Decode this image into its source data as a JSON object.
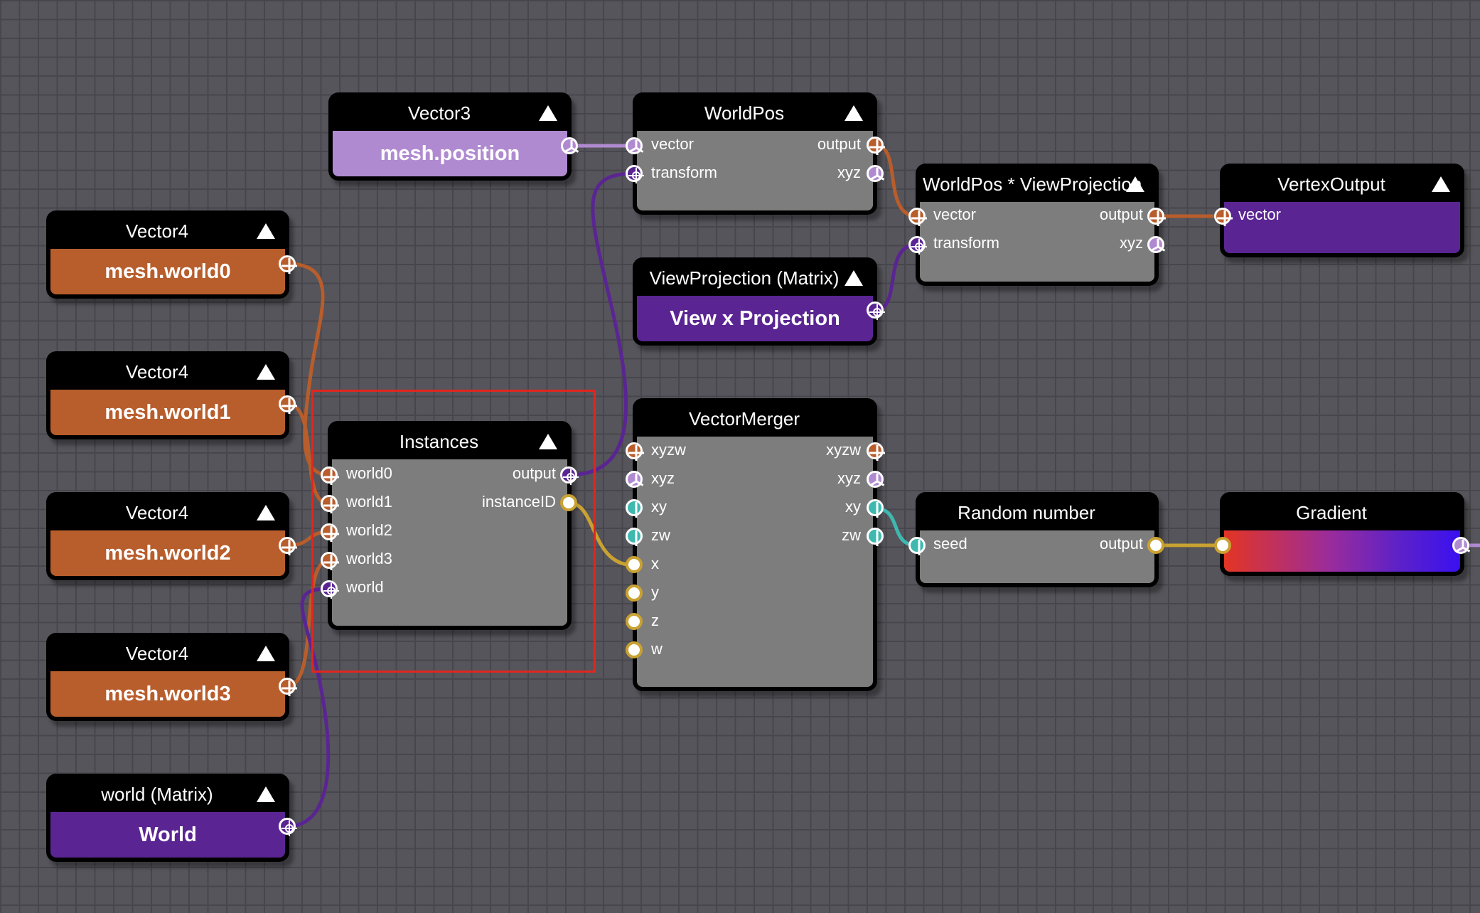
{
  "colors": {
    "vec4": "#b85d2c",
    "vec3": "#b08ad0",
    "matrix": "#5a2593",
    "vec2": "#3fb8b0",
    "float": "#c9a232",
    "node_body": "#7d7d7d",
    "selection": "#e0261f"
  },
  "nodes": {
    "vector3": {
      "title": "Vector3",
      "value": "mesh.position"
    },
    "worldpos": {
      "title": "WorldPos",
      "inputs": [
        "vector",
        "transform"
      ],
      "outputs": [
        "output",
        "xyz"
      ]
    },
    "vector4_0": {
      "title": "Vector4",
      "value": "mesh.world0"
    },
    "vector4_1": {
      "title": "Vector4",
      "value": "mesh.world1"
    },
    "vector4_2": {
      "title": "Vector4",
      "value": "mesh.world2"
    },
    "vector4_3": {
      "title": "Vector4",
      "value": "mesh.world3"
    },
    "world_matrix": {
      "title": "world (Matrix)",
      "value": "World"
    },
    "instances": {
      "title": "Instances",
      "inputs": [
        "world0",
        "world1",
        "world2",
        "world3",
        "world"
      ],
      "outputs": [
        "output",
        "instanceID"
      ]
    },
    "viewprojection": {
      "title": "ViewProjection (Matrix)",
      "value": "View x Projection"
    },
    "worldpos_vp": {
      "title": "WorldPos * ViewProjection",
      "inputs": [
        "vector",
        "transform"
      ],
      "outputs": [
        "output",
        "xyz"
      ]
    },
    "vertexoutput": {
      "title": "VertexOutput",
      "inputs": [
        "vector"
      ]
    },
    "vectormerger": {
      "title": "VectorMerger",
      "inputs": [
        "xyzw",
        "xyz",
        "xy",
        "zw",
        "x",
        "y",
        "z",
        "w"
      ],
      "outputs": [
        "xyzw",
        "xyz",
        "xy",
        "zw"
      ]
    },
    "random": {
      "title": "Random number",
      "inputs": [
        "seed"
      ],
      "outputs": [
        "output"
      ]
    },
    "gradient": {
      "title": "Gradient"
    }
  }
}
